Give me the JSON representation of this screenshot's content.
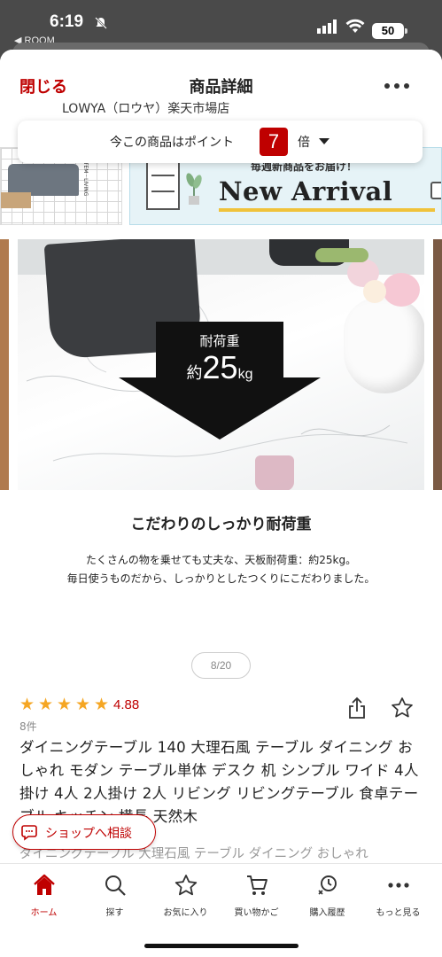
{
  "status": {
    "time": "6:19",
    "back_app": "◀ ROOM",
    "battery": "50"
  },
  "nav": {
    "close": "閉じる",
    "title": "商品詳細"
  },
  "shop_name_partial": "LOWYA（ロウヤ）楽天市場店",
  "banner": {
    "side_text": "ITEM · LIVING",
    "subtitle": "毎週新商品をお届け！",
    "headline": "New Arrival"
  },
  "points": {
    "label": "今この商品はポイント",
    "multiplier": "7",
    "unit": "倍"
  },
  "image_overlay": {
    "load_label": "耐荷重",
    "load_prefix": "約",
    "load_number": "25",
    "load_unit": "kg"
  },
  "feature": {
    "title": "こだわりのしっかり耐荷重",
    "line1": "たくさんの物を乗せても丈夫な、天板耐荷重：約25kg。",
    "line2": "毎日使うものだから、しっかりとしたつくりにこだわりました。"
  },
  "carousel": {
    "page": "8/20"
  },
  "review": {
    "stars": [
      "★",
      "★",
      "★",
      "★",
      "★"
    ],
    "rating": "4.88",
    "count": "8件"
  },
  "product": {
    "title": "ダイニングテーブル 140 大理石風 テーブル ダイニング おしゃれ モダン テーブル単体 デスク 机 シンプル ワイド 4人掛け 4人 2人掛け 2人 リビング リビングテーブル 食卓テーブル キッチン 横長 天然木",
    "subtitle": "ダイニングテーブル 大理石風 テーブル ダイニング おしゃれ"
  },
  "consult": {
    "label": "ショップへ相談"
  },
  "tabs": [
    {
      "label": "ホーム",
      "icon": "home-icon",
      "active": true
    },
    {
      "label": "探す",
      "icon": "search-icon",
      "active": false
    },
    {
      "label": "お気に入り",
      "icon": "star-icon",
      "active": false
    },
    {
      "label": "買い物かご",
      "icon": "cart-icon",
      "active": false
    },
    {
      "label": "購入履歴",
      "icon": "history-icon",
      "active": false
    },
    {
      "label": "もっと見る",
      "icon": "more-icon",
      "active": false
    }
  ],
  "colors": {
    "brand_red": "#bf0000",
    "star": "#f5a623"
  }
}
